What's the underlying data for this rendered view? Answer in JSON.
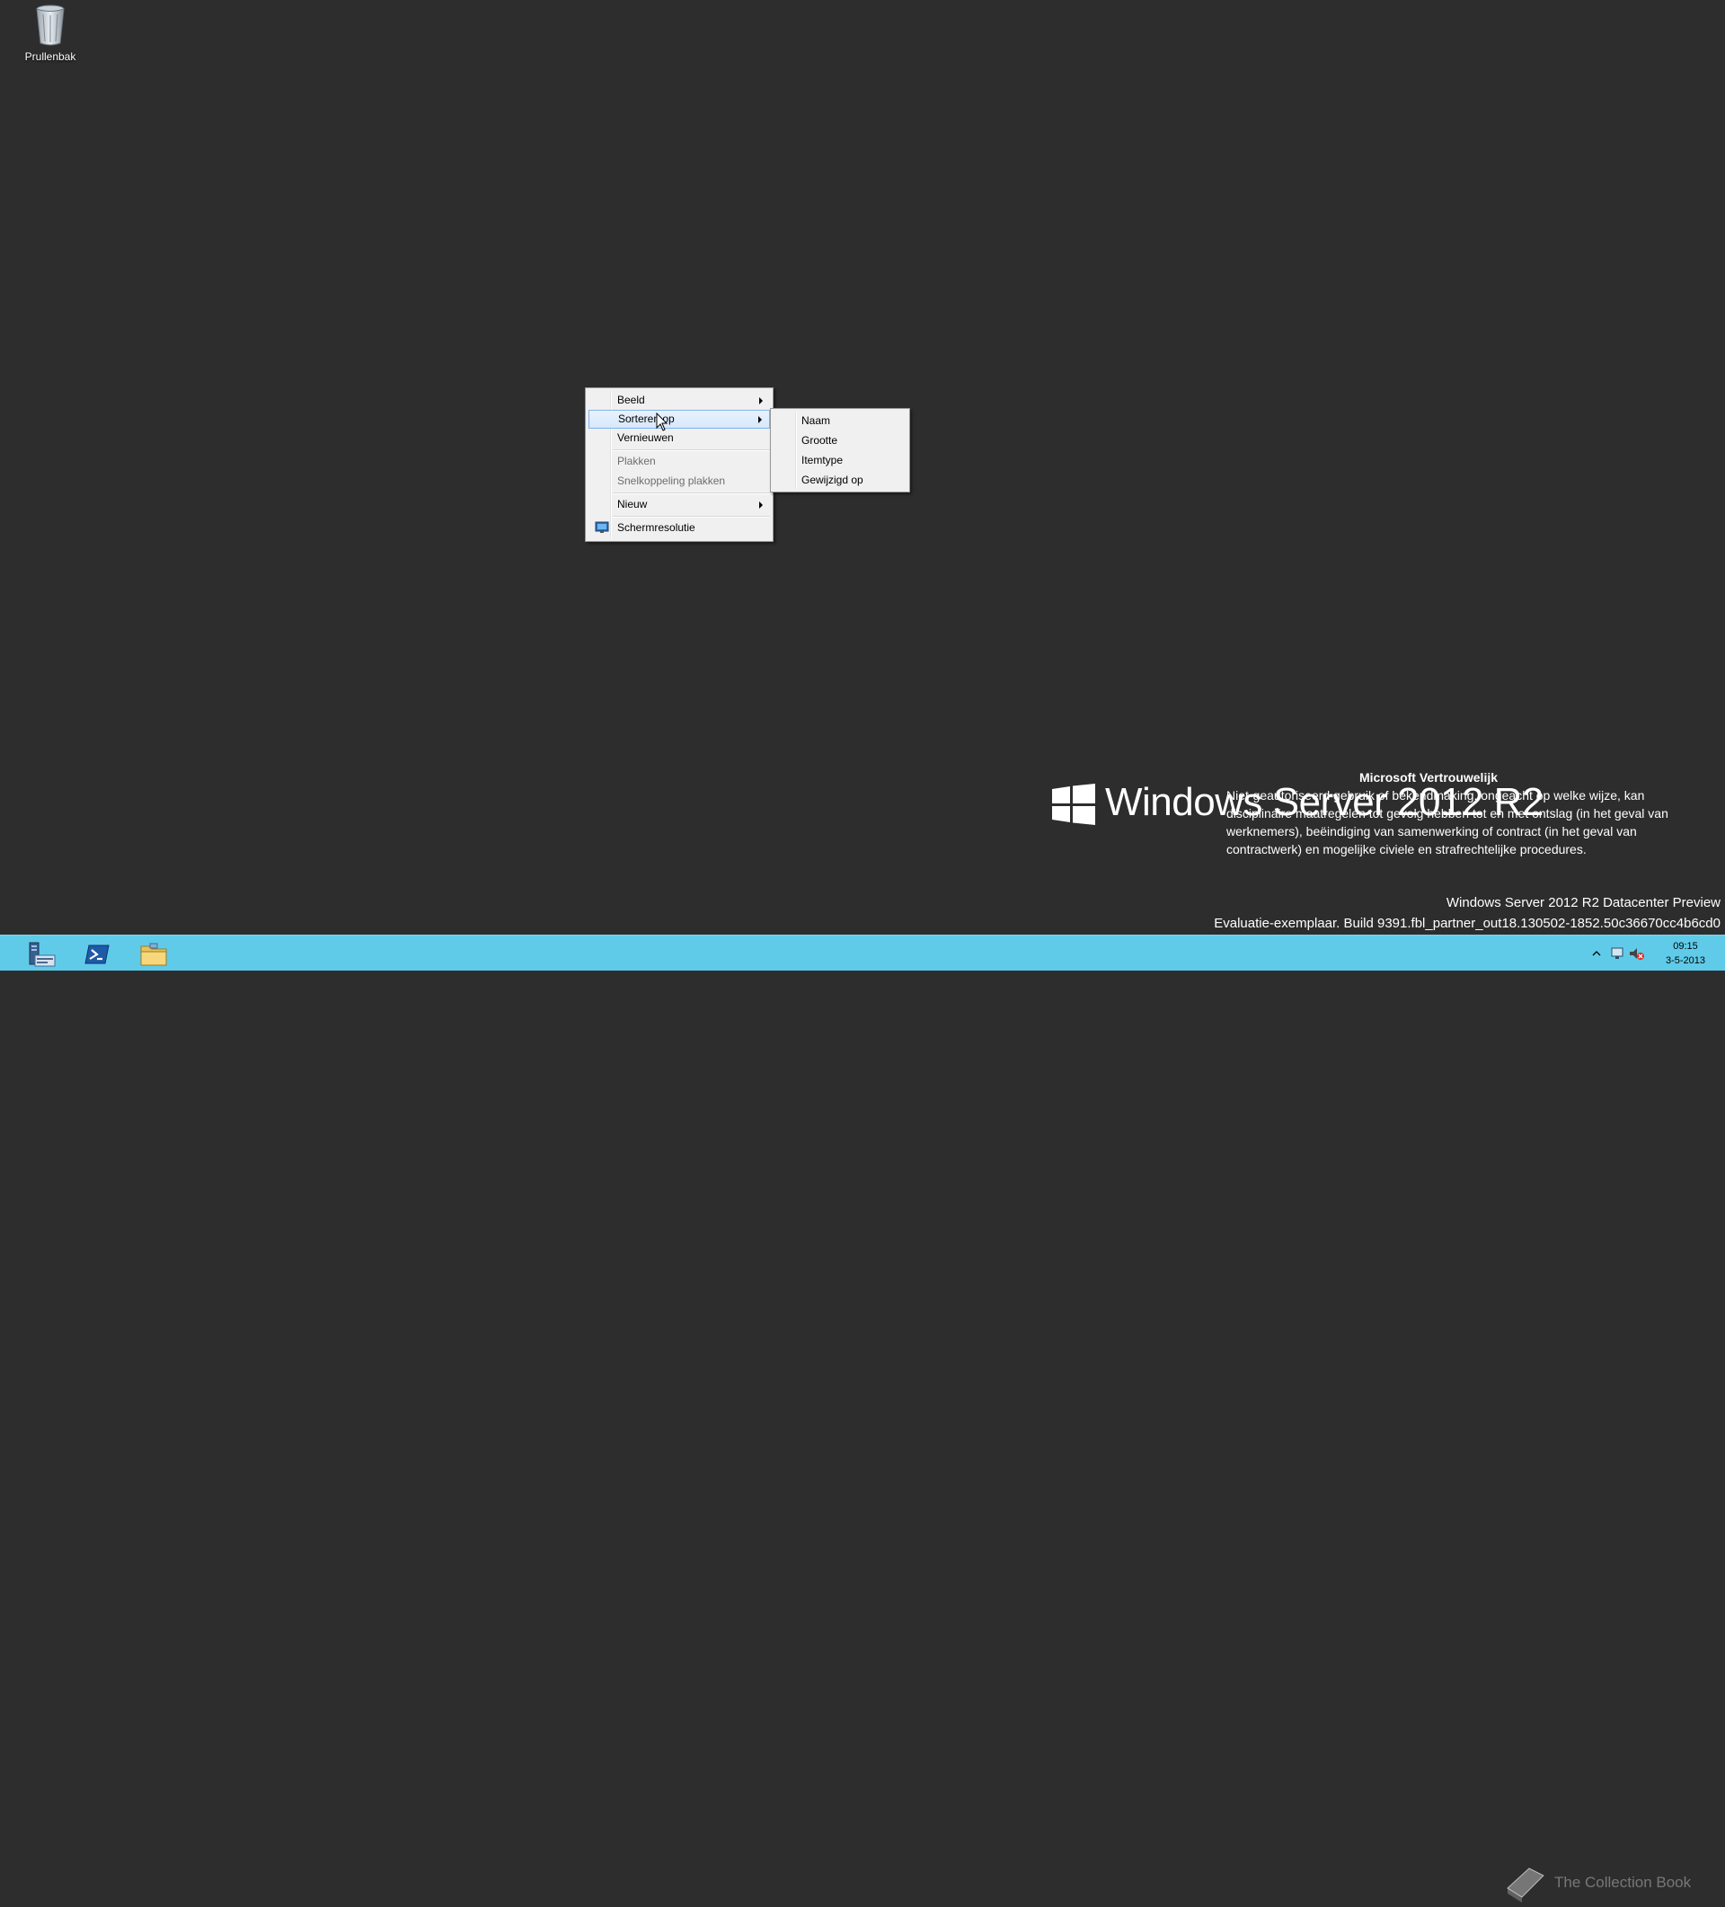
{
  "desktop": {
    "recycle_bin_label": "Prullenbak"
  },
  "context_menu": {
    "items": [
      {
        "label": "Beeld",
        "has_submenu": true,
        "disabled": false
      },
      {
        "label": "Sorteren op",
        "has_submenu": true,
        "disabled": false,
        "highlighted": true
      },
      {
        "label": "Vernieuwen",
        "has_submenu": false,
        "disabled": false
      },
      {
        "label": "Plakken",
        "has_submenu": false,
        "disabled": true
      },
      {
        "label": "Snelkoppeling plakken",
        "has_submenu": false,
        "disabled": true
      },
      {
        "label": "Nieuw",
        "has_submenu": true,
        "disabled": false
      },
      {
        "label": "Schermresolutie",
        "has_submenu": false,
        "disabled": false,
        "icon": "display-settings-icon"
      }
    ]
  },
  "submenu": {
    "items": [
      {
        "label": "Naam"
      },
      {
        "label": "Grootte"
      },
      {
        "label": "Itemtype"
      },
      {
        "label": "Gewijzigd op"
      }
    ]
  },
  "branding": {
    "product_logo_text": "Windows Server 2012 R2",
    "confidential_title": "Microsoft Vertrouwelijk",
    "confidential_body": "Niet-geautoriseerd gebruik of bekendmaking, ongeacht op welke wijze, kan disciplinaire maatregelen tot gevolg hebben tot en met ontslag (in het geval van werknemers), beëindiging van samenwerking of contract (in het geval van contractwerk) en mogelijke civiele en strafrechtelijke procedures.",
    "edition": "Windows Server 2012 R2 Datacenter Preview",
    "build": "Evaluatie-exemplaar. Build 9391.fbl_partner_out18.130502-1852.50c36670cc4b6cd0"
  },
  "taskbar": {
    "pinned": [
      {
        "name": "server-manager-icon"
      },
      {
        "name": "powershell-icon"
      },
      {
        "name": "file-explorer-icon"
      }
    ],
    "watermark": "The Collection Book",
    "clock_time": "09:15",
    "clock_date": "3-5-2013"
  },
  "colors": {
    "desktop_background": "#2d2d2d",
    "taskbar": "#5fcbe9",
    "menu_background": "#f0f0f0",
    "menu_highlight_border": "#7eb4ea"
  }
}
